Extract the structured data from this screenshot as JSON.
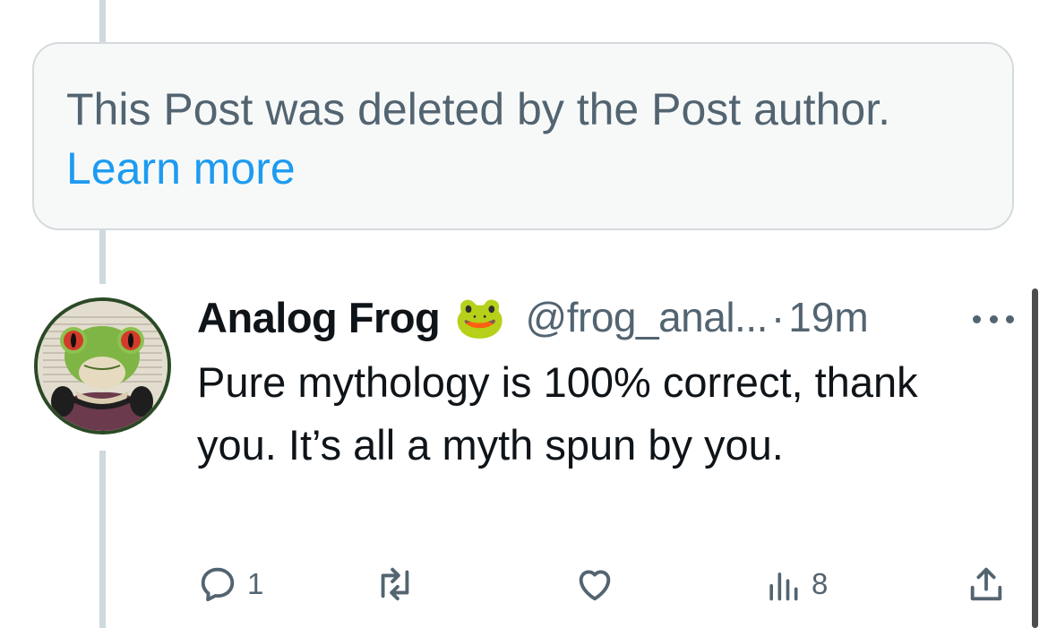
{
  "deleted_notice": {
    "message": "This Post was deleted by the Post author.",
    "link_label": "Learn more"
  },
  "reply": {
    "author": {
      "display_name": "Analog Frog",
      "name_emoji": "🐸",
      "handle": "@frog_anal...",
      "separator": "·",
      "time_ago": "19m",
      "avatar_icon": "frog-with-headphones-avatar"
    },
    "text": "Pure mythology is 100% correct, thank you. It’s all a myth spun by you.",
    "actions": {
      "reply_count": "1",
      "repost_count": "",
      "like_count": "",
      "views_count": "8"
    }
  },
  "colors": {
    "text_primary": "#0f1419",
    "text_secondary": "#536471",
    "link": "#1d9bf0",
    "thread_line": "#cfd9de",
    "box_background": "#f7f9f9",
    "box_border": "#d5dade"
  },
  "icons": [
    "reply-icon",
    "repost-icon",
    "like-icon",
    "views-icon",
    "share-icon",
    "more-icon"
  ]
}
